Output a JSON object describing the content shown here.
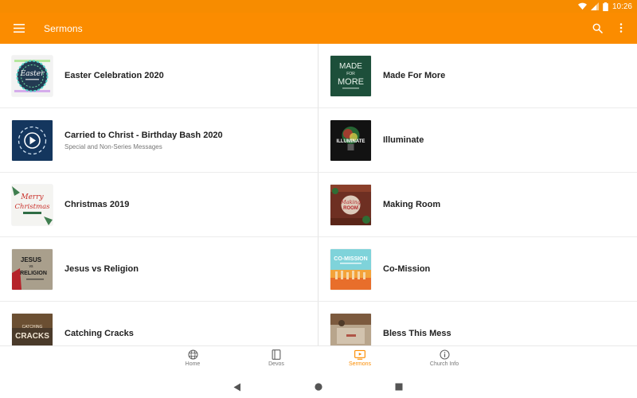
{
  "status": {
    "time": "10:26"
  },
  "appbar": {
    "title": "Sermons"
  },
  "sermons": [
    {
      "title": "Easter Celebration 2020",
      "subtitle": ""
    },
    {
      "title": "Made For More",
      "subtitle": ""
    },
    {
      "title": "Carried to Christ - Birthday Bash 2020",
      "subtitle": "Special and Non-Series Messages"
    },
    {
      "title": "Illuminate",
      "subtitle": ""
    },
    {
      "title": "Christmas 2019",
      "subtitle": ""
    },
    {
      "title": "Making Room",
      "subtitle": ""
    },
    {
      "title": "Jesus vs Religion",
      "subtitle": ""
    },
    {
      "title": "Co-Mission",
      "subtitle": ""
    },
    {
      "title": "Catching Cracks",
      "subtitle": ""
    },
    {
      "title": "Bless This Mess",
      "subtitle": ""
    }
  ],
  "thumb_text": {
    "easter": "Easter",
    "made_line1": "MADE",
    "made_line2": "FOR",
    "made_line3": "MORE",
    "illuminate": "ILLUMINATE",
    "christmas_line1": "Merry",
    "christmas_line2": "Christmas",
    "making_room_line1": "Making",
    "making_room_line2": "ROOM",
    "jesus_line1": "JESUS",
    "jesus_line2": "vs",
    "jesus_line3": "RELIGION",
    "comission": "CO-MISSION",
    "catching_line1": "CATCHING",
    "catching_line2": "CRACKS"
  },
  "bottom_nav": [
    {
      "label": "Home",
      "icon": "globe-icon",
      "active": false
    },
    {
      "label": "Devos",
      "icon": "book-icon",
      "active": false
    },
    {
      "label": "Sermons",
      "icon": "video-icon",
      "active": true
    },
    {
      "label": "Church Info",
      "icon": "info-icon",
      "active": false
    }
  ],
  "colors": {
    "accent": "#fb8c00",
    "statusbar": "#f78c00"
  }
}
